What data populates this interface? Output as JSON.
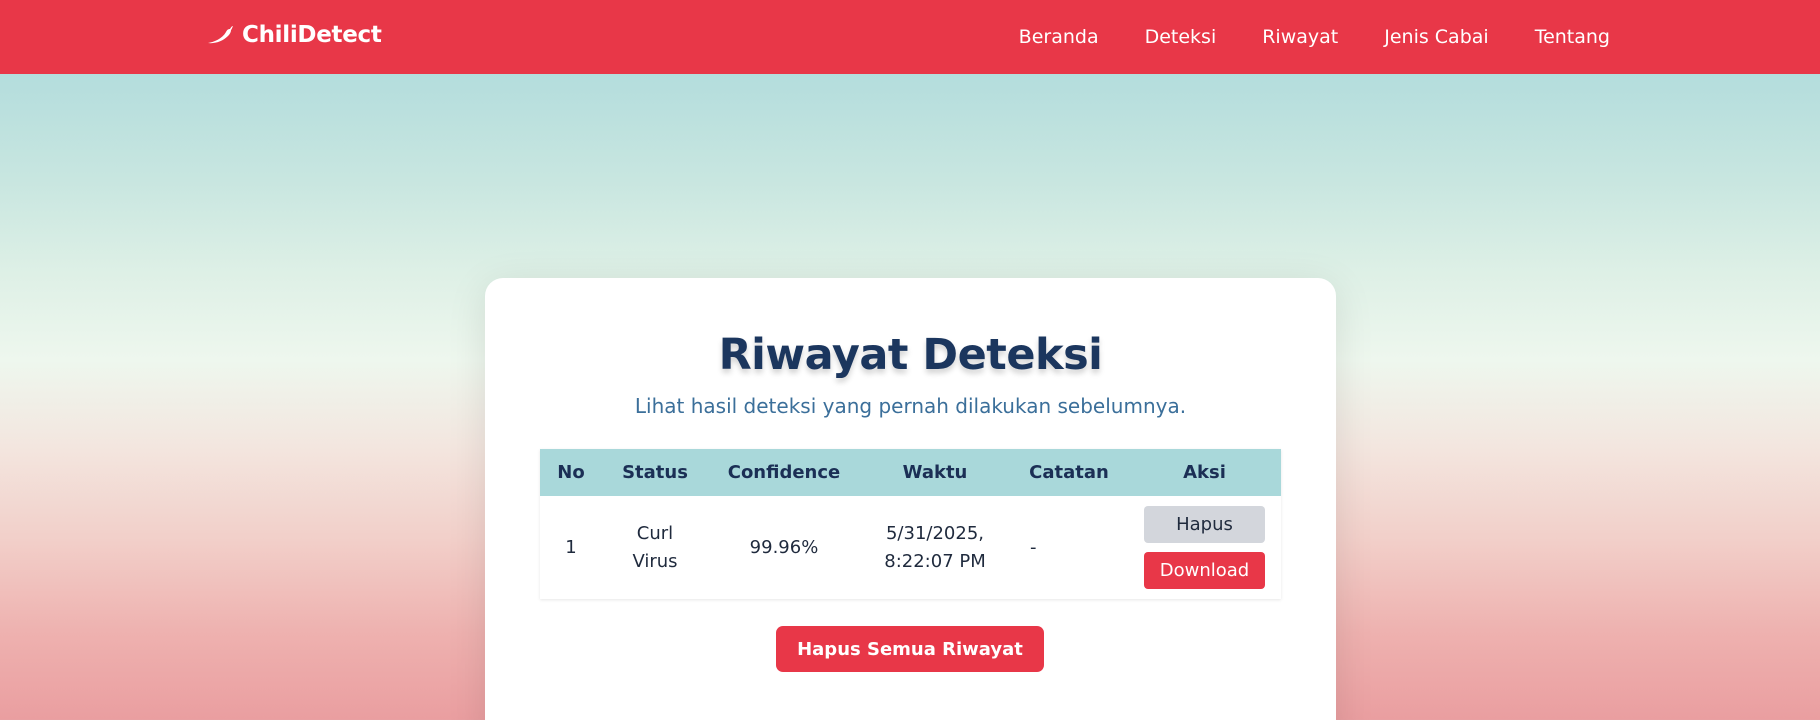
{
  "navbar": {
    "brand": "ChiliDetect",
    "brand_icon": "chili-icon",
    "links": [
      "Beranda",
      "Deteksi",
      "Riwayat",
      "Jenis Cabai",
      "Tentang"
    ]
  },
  "main": {
    "title": "Riwayat Deteksi",
    "subtitle": "Lihat hasil deteksi yang pernah dilakukan sebelumnya.",
    "table": {
      "headers": [
        "No",
        "Status",
        "Confidence",
        "Waktu",
        "Catatan",
        "Aksi"
      ],
      "rows": [
        {
          "no": "1",
          "status": "Curl Virus",
          "confidence": "99.96%",
          "waktu": "5/31/2025, 8:22:07 PM",
          "catatan": "-",
          "actions": {
            "delete": "Hapus",
            "download": "Download"
          }
        }
      ]
    },
    "clear_all_label": "Hapus Semua Riwayat"
  },
  "colors": {
    "brand": "#e83748",
    "header_bg": "#a9d8da",
    "title": "#1b365e",
    "subtitle": "#3b6f9a"
  }
}
